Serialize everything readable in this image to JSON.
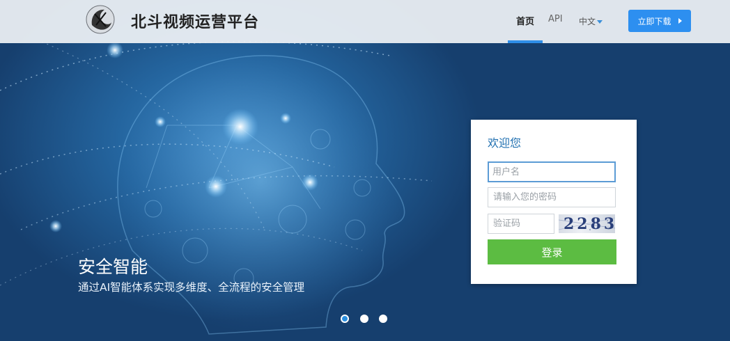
{
  "nav": {
    "brand": "北斗视频运营平台",
    "home": "首页",
    "api": "API",
    "lang": "中文",
    "download": "立即下载"
  },
  "slide": {
    "title": "安全智能",
    "description": "通过AI智能体系实现多维度、全流程的安全管理",
    "count": 3,
    "active": 1
  },
  "login": {
    "title": "欢迎您",
    "username_placeholder": "用户名",
    "password_placeholder": "请输入您的密码",
    "captcha_placeholder": "验证码",
    "captcha_code": "2283",
    "submit": "登录"
  },
  "colors": {
    "accent": "#2d8ff0",
    "login_button": "#5cbc42",
    "login_title": "#1f6fb0"
  },
  "icons": [
    "logo-icon",
    "caret-down-icon",
    "play-icon"
  ]
}
